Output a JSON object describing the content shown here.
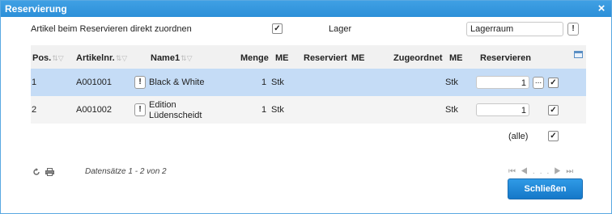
{
  "dialog": {
    "title": "Reservierung",
    "close_icon": "×"
  },
  "options": {
    "assign_label": "Artikel beim Reservieren direkt zuordnen",
    "assign_checked": true,
    "lager_label": "Lager",
    "lager_value": "Lagerraum"
  },
  "grid": {
    "columns": {
      "pos": "Pos.",
      "artikelnr": "Artikelnr.",
      "name1": "Name1",
      "menge": "Menge",
      "me1": "ME",
      "reserviert": "Reserviert",
      "me2": "ME",
      "zugeordnet": "Zugeordnet",
      "me3": "ME",
      "reservieren": "Reservieren"
    },
    "rows": [
      {
        "pos": "1",
        "artikelnr": "A001001",
        "name_line1": "Black & White",
        "name_line2": "",
        "menge": "1",
        "me": "Stk",
        "reserviert": "",
        "zugeordnet_me": "Stk",
        "reservieren": "1",
        "checked": true,
        "selected": true
      },
      {
        "pos": "2",
        "artikelnr": "A001002",
        "name_line1": "Edition",
        "name_line2": "Lüdenscheidt",
        "menge": "1",
        "me": "Stk",
        "reserviert": "",
        "zugeordnet_me": "Stk",
        "reservieren": "1",
        "checked": true,
        "selected": false
      }
    ],
    "all_label": "(alle)",
    "all_checked": true
  },
  "footer": {
    "records_text": "Datensätze 1 - 2 von 2",
    "pager_dots": "..."
  },
  "buttons": {
    "close_label": "Schließen"
  },
  "icons": {
    "refresh": "refresh-icon",
    "print": "print-icon",
    "export": "export-icon",
    "info": "!"
  },
  "colors": {
    "title_bar": "#2c8fd8",
    "selected_row": "#c5dcf6",
    "primary_button": "#1f88d6"
  }
}
